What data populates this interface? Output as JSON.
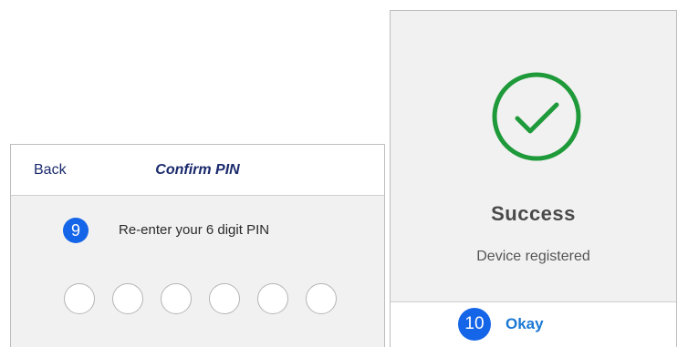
{
  "confirm_pin": {
    "back_label": "Back",
    "title": "Confirm PIN",
    "step_number": "9",
    "instruction": "Re-enter your 6 digit PIN",
    "pin_length": 6,
    "filled_digits": 0
  },
  "success": {
    "icon": "check-circle-icon",
    "title": "Success",
    "message": "Device registered",
    "step_number": "10",
    "okay_label": "Okay"
  },
  "colors": {
    "badge_blue": "#1565e8",
    "nav_text": "#1a2a6c",
    "success_green": "#1f9a3a",
    "okay_blue": "#1a78d4",
    "panel_bg": "#f2f1f1"
  }
}
